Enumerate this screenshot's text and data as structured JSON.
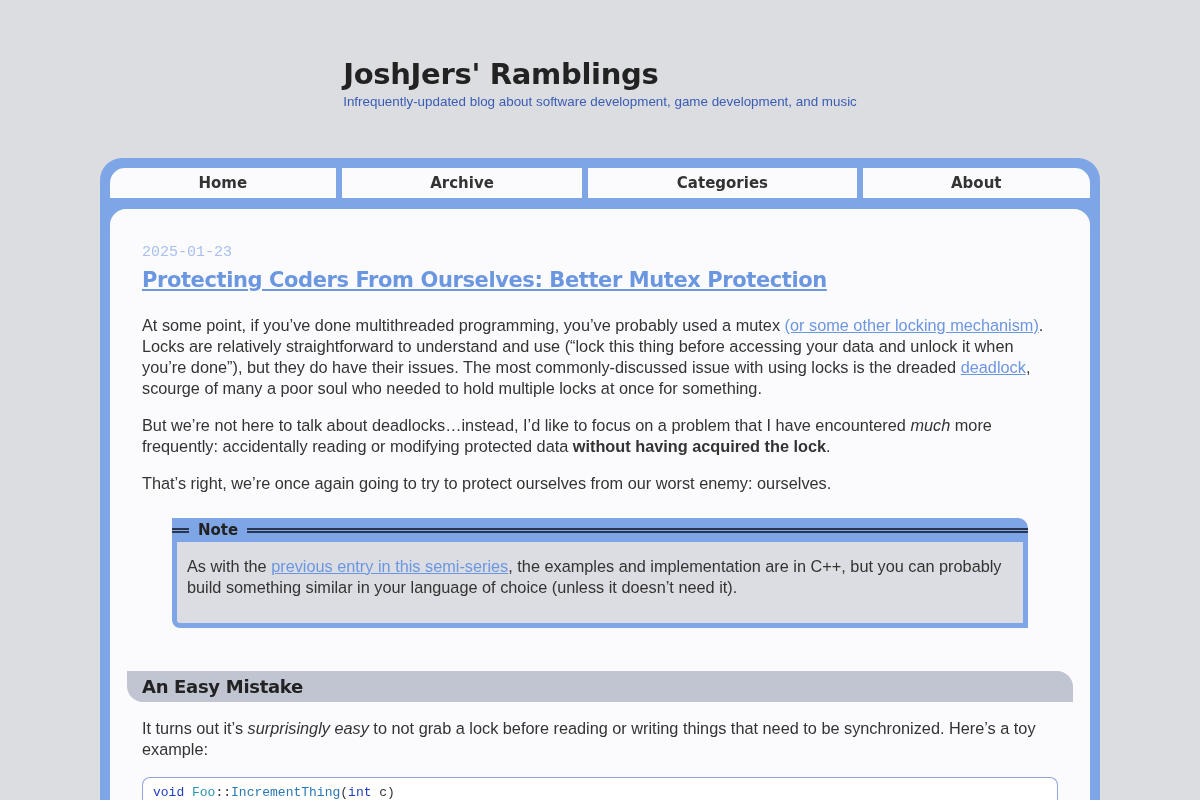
{
  "header": {
    "title": "JoshJers' Ramblings",
    "tagline": "Infrequently-updated blog about software development, game development, and music"
  },
  "nav": {
    "items": [
      {
        "label": "Home"
      },
      {
        "label": "Archive"
      },
      {
        "label": "Categories"
      },
      {
        "label": "About"
      }
    ]
  },
  "post": {
    "date": "2025-01-23",
    "title": "Protecting Coders From Ourselves: Better Mutex Protection",
    "blocks": [
      {
        "kind": "paragraph",
        "segments": [
          {
            "kind": "text",
            "text": "At some point, if you’ve done multithreaded programming, you’ve probably used a mutex "
          },
          {
            "kind": "link",
            "text": "(or some other locking mechanism)"
          },
          {
            "kind": "text",
            "text": ". Locks are relatively straightforward to understand and use (“lock this thing before accessing your data and unlock it when you’re done”), but they do have their issues. The most commonly-discussed issue with using locks is the dreaded "
          },
          {
            "kind": "link",
            "text": "deadlock"
          },
          {
            "kind": "text",
            "text": ", scourge of many a poor soul who needed to hold multiple locks at once for something."
          }
        ]
      },
      {
        "kind": "paragraph",
        "segments": [
          {
            "kind": "text",
            "text": "But we’re not here to talk about deadlocks…instead, I’d like to focus on a problem that I have encountered *much* more frequently: accidentally reading or modifying protected data **without having acquired the lock**."
          }
        ]
      },
      {
        "kind": "paragraph",
        "segments": [
          {
            "kind": "text",
            "text": "That’s right, we’re once again going to try to protect ourselves from our worst enemy: ourselves."
          }
        ]
      },
      {
        "kind": "note",
        "title": "Note",
        "segments": [
          {
            "kind": "text",
            "text": "As with the "
          },
          {
            "kind": "link",
            "text": "previous entry in this semi-series"
          },
          {
            "kind": "text",
            "text": ", the examples and implementation are in C++, but you can probably build something similar in your language of choice (unless it doesn’t need it)."
          }
        ]
      },
      {
        "kind": "heading",
        "text": "An Easy Mistake"
      },
      {
        "kind": "paragraph",
        "segments": [
          {
            "kind": "text",
            "text": "It turns out it’s *surprisingly easy* to not grab a lock before reading or writing things that need to be synchronized. Here’s a toy example:"
          }
        ]
      },
      {
        "kind": "code",
        "lines": [
          [
            {
              "kind": "keyword",
              "text": "void"
            },
            {
              "kind": "type",
              "text": " Foo"
            },
            {
              "kind": "plain",
              "text": "::"
            },
            {
              "kind": "function",
              "text": "IncrementThing"
            },
            {
              "kind": "plain",
              "text": "("
            },
            {
              "kind": "keyword",
              "text": "int"
            },
            {
              "kind": "plain",
              "text": " c)"
            }
          ]
        ]
      }
    ]
  }
}
